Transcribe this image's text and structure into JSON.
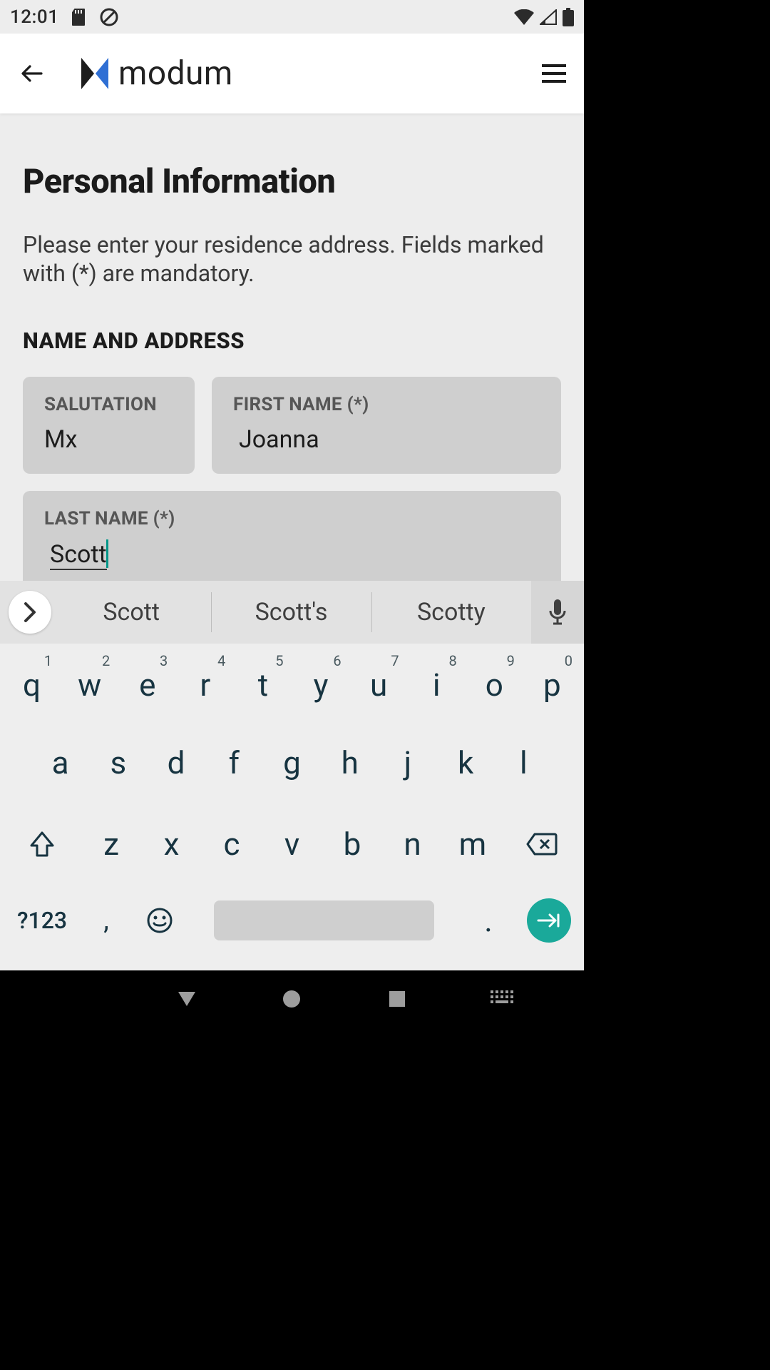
{
  "status": {
    "time": "12:01"
  },
  "appbar": {
    "brand": "modum"
  },
  "page": {
    "title": "Personal Information",
    "subtitle": "Please enter your residence address. Fields marked with (*) are mandatory.",
    "section": "NAME AND ADDRESS"
  },
  "form": {
    "salutation": {
      "label": "SALUTATION",
      "value": "Mx"
    },
    "first_name": {
      "label": "FIRST NAME (*)",
      "value": "Joanna"
    },
    "last_name": {
      "label": "LAST NAME (*)",
      "value": "Scott"
    }
  },
  "suggestions": [
    "Scott",
    "Scott's",
    "Scotty"
  ],
  "keyboard": {
    "row1": [
      {
        "k": "q",
        "n": "1"
      },
      {
        "k": "w",
        "n": "2"
      },
      {
        "k": "e",
        "n": "3"
      },
      {
        "k": "r",
        "n": "4"
      },
      {
        "k": "t",
        "n": "5"
      },
      {
        "k": "y",
        "n": "6"
      },
      {
        "k": "u",
        "n": "7"
      },
      {
        "k": "i",
        "n": "8"
      },
      {
        "k": "o",
        "n": "9"
      },
      {
        "k": "p",
        "n": "0"
      }
    ],
    "row2": [
      "a",
      "s",
      "d",
      "f",
      "g",
      "h",
      "j",
      "k",
      "l"
    ],
    "row3": [
      "z",
      "x",
      "c",
      "v",
      "b",
      "n",
      "m"
    ],
    "sym": "?123",
    "comma": ",",
    "period": "."
  },
  "colors": {
    "accent": "#1aa99a",
    "caret": "#009688"
  }
}
